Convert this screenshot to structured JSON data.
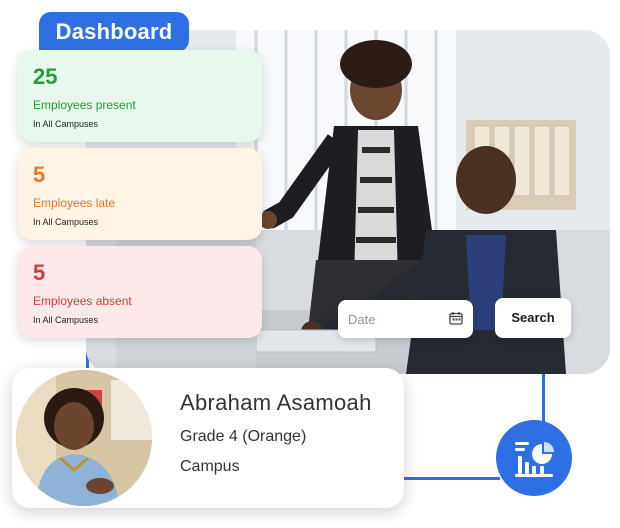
{
  "dashboard": {
    "title": "Dashboard"
  },
  "stats": [
    {
      "value": "25",
      "label": "Employees present",
      "scope": "In All Campuses"
    },
    {
      "value": "5",
      "label": "Employees late",
      "scope": "In All Campuses"
    },
    {
      "value": "5",
      "label": "Employees absent",
      "scope": "In All Campuses"
    }
  ],
  "search": {
    "date_placeholder": "Date",
    "button_label": "Search"
  },
  "profile": {
    "name": "Abraham Asamoah",
    "grade": "Grade 4 (Orange)",
    "campus": "Campus"
  },
  "icons": {
    "calendar": "calendar-icon",
    "report": "report-chart-icon"
  },
  "colors": {
    "accent": "#2f6fe4",
    "present": "#1f9d3a",
    "late": "#e8742a",
    "absent": "#d63b3b"
  }
}
